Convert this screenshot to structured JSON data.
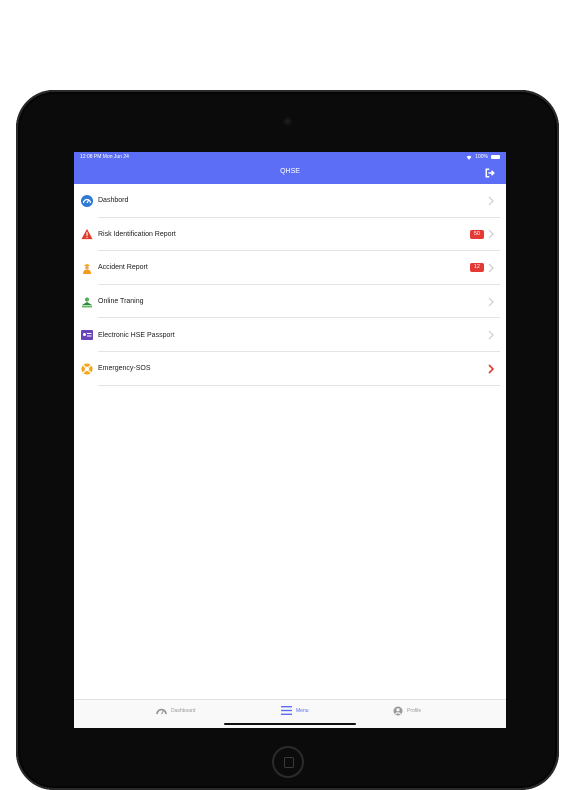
{
  "status": {
    "time": "12:08 PM   Mon Jun 24",
    "battery": "100%"
  },
  "nav": {
    "title": "QHSE"
  },
  "menu": [
    {
      "label": "Dashbord",
      "badge": ""
    },
    {
      "label": "Risk Identification Report",
      "badge": "50"
    },
    {
      "label": "Accident Report",
      "badge": "12"
    },
    {
      "label": "Online Traning",
      "badge": ""
    },
    {
      "label": "Electronic HSE Passport",
      "badge": ""
    },
    {
      "label": "Emergency-SOS",
      "badge": ""
    }
  ],
  "tabs": [
    {
      "label": "Dashboard"
    },
    {
      "label": "Menu"
    },
    {
      "label": "Profile"
    }
  ],
  "colors": {
    "accent": "#5b6ef5",
    "badge": "#e53935",
    "sos_chevron": "#e53935"
  }
}
